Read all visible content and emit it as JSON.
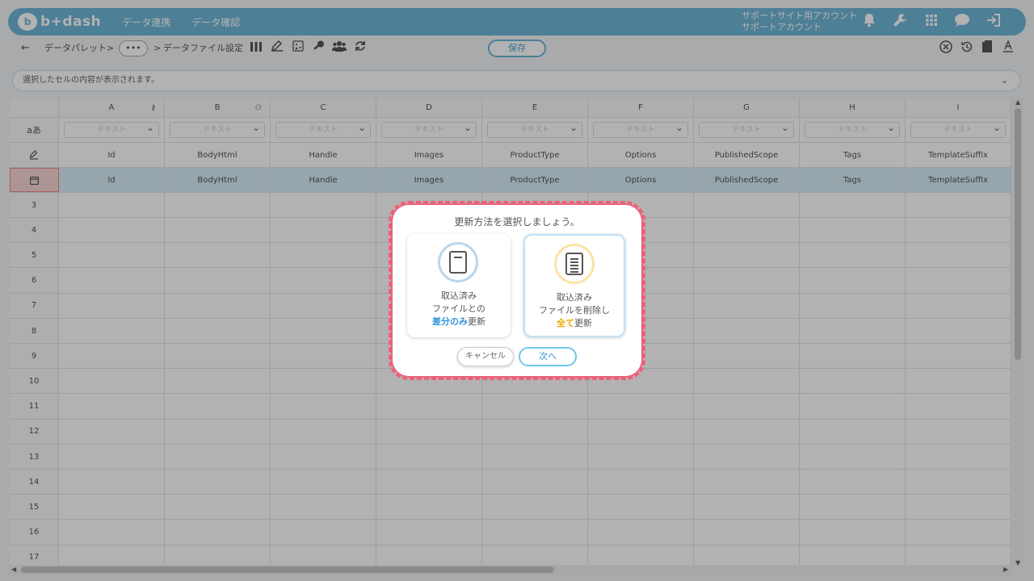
{
  "header": {
    "logo_text": "b+dash",
    "nav": [
      "データ連携",
      "データ確認"
    ],
    "account_line1": "サポートサイト用アカウント",
    "account_line2": "サポートアカウント"
  },
  "toolbar": {
    "back": "←",
    "crumb1": "データパレット",
    "sep1": ">",
    "ellipsis": "•••",
    "sep2": ">",
    "crumb2": "データファイル設定",
    "save_label": "保存"
  },
  "preview": {
    "placeholder": "選択したセルの内容が表示されます。"
  },
  "grid": {
    "columns": [
      "A",
      "B",
      "C",
      "D",
      "E",
      "F",
      "G",
      "H",
      "I"
    ],
    "type_row_label": "aあ",
    "type_placeholder": "テキスト",
    "names": [
      "Id",
      "BodyHtml",
      "Handle",
      "Images",
      "ProductType",
      "Options",
      "PublishedScope",
      "Tags",
      "TemplateSuffix"
    ],
    "row_numbers": [
      "3",
      "4",
      "5",
      "6",
      "7",
      "8",
      "9",
      "10",
      "11",
      "12",
      "13",
      "14",
      "15",
      "16",
      "17"
    ]
  },
  "modal": {
    "title": "更新方法を選択しましょう。",
    "option1": {
      "line1": "取込済み",
      "line2": "ファイルとの",
      "highlight": "差分のみ",
      "rest": "更新"
    },
    "option2": {
      "line1": "取込済み",
      "line2": "ファイルを削除し",
      "highlight": "全て",
      "rest": "更新"
    },
    "cancel_label": "キャンセル",
    "next_label": "次へ"
  },
  "colors": {
    "accent": "#6fb6d7",
    "highlight_blue": "#2f95d9",
    "highlight_orange": "#f0a500",
    "modal_border": "#ee5f78"
  }
}
